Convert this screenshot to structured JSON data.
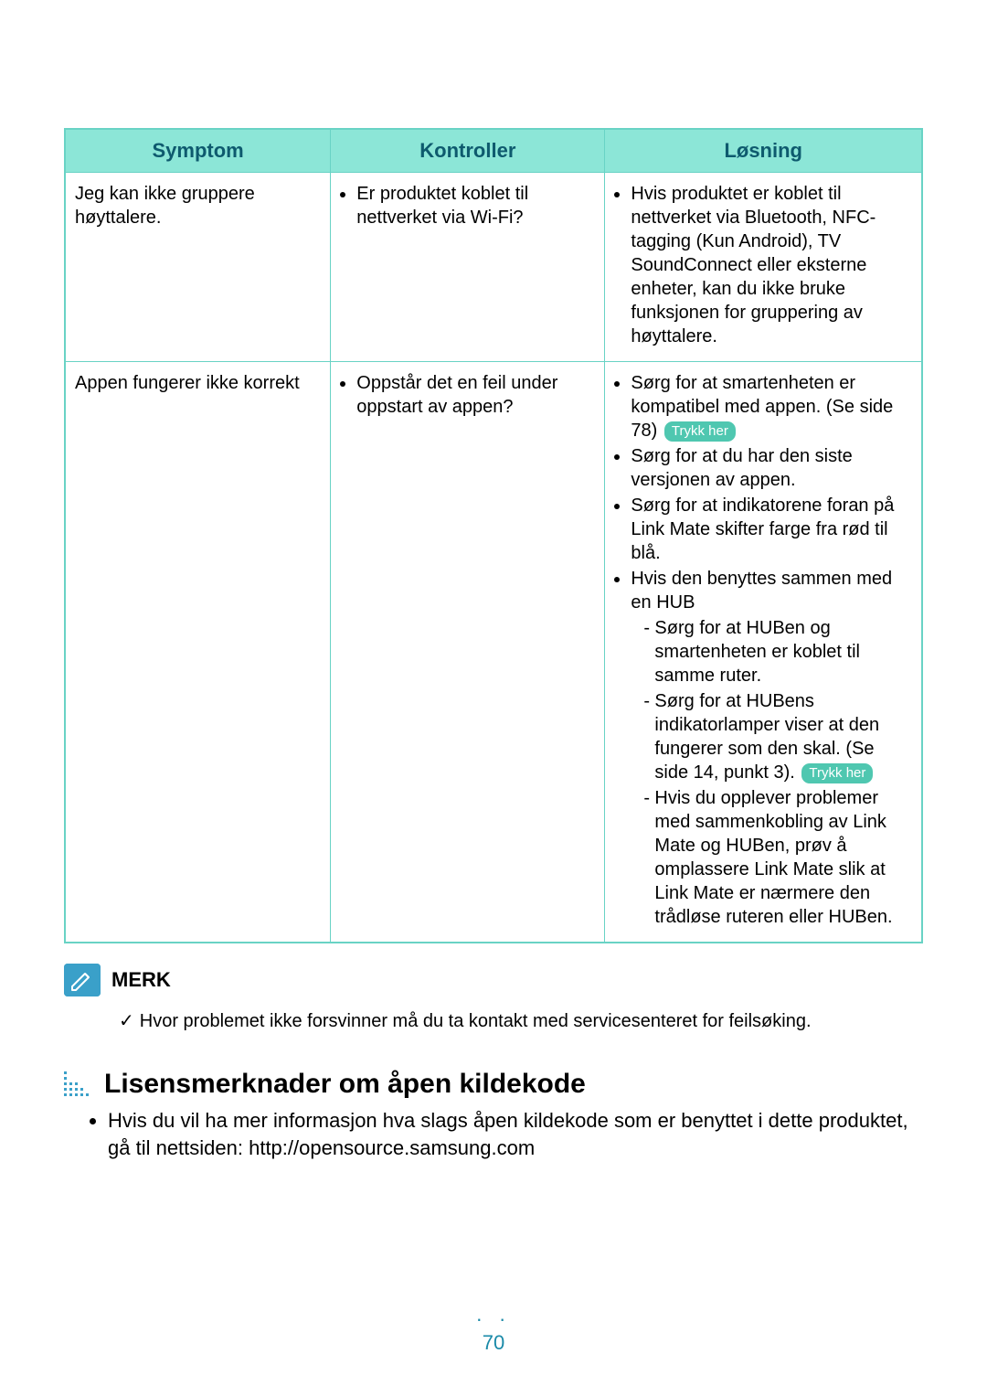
{
  "table": {
    "headers": [
      "Symptom",
      "Kontroller",
      "Løsning"
    ],
    "rows": [
      {
        "symptom": "Jeg kan ikke gruppere høyttalere.",
        "check": "Er produktet koblet til nettverket via Wi-Fi?",
        "solution_b1": "Hvis produktet er koblet til nettverket via Bluetooth, NFC-tagging (Kun Android), TV SoundConnect eller eksterne enheter, kan du ikke bruke funksjonen for gruppering av høyttalere."
      },
      {
        "symptom": "Appen fungerer ikke korrekt",
        "check": "Oppstår det en feil under oppstart av appen?",
        "solution": {
          "s1a": "Sørg for at smartenheten er kompatibel med appen. (Se side 78)",
          "link1": "Trykk her",
          "s2": "Sørg for at du har den siste versjonen av appen.",
          "s3": "Sørg for at indikatorene foran på Link Mate skifter farge fra rød til blå.",
          "s4": "Hvis den benyttes sammen med en HUB",
          "d1": "Sørg for at HUBen og smartenheten er koblet til samme ruter.",
          "d2a": "Sørg for at HUBens indikatorlamper viser at den fungerer som den skal. (Se side 14, punkt 3).",
          "link2": "Trykk her",
          "d3": "Hvis du opplever problemer med sammenkobling av Link Mate og HUBen, prøv å omplassere Link Mate slik at Link Mate er nærmere den trådløse ruteren eller HUBen."
        }
      }
    ]
  },
  "note": {
    "label": "MERK",
    "text": "Hvor problemet ikke forsvinner må du ta kontakt med servicesenteret for feilsøking."
  },
  "section": {
    "heading": "Lisensmerknader om åpen kildekode",
    "bullet": "Hvis du vil ha mer informasjon hva slags åpen kildekode som er benyttet i dette produktet, gå til nettsiden: http://opensource.samsung.com"
  },
  "page_number": "70"
}
